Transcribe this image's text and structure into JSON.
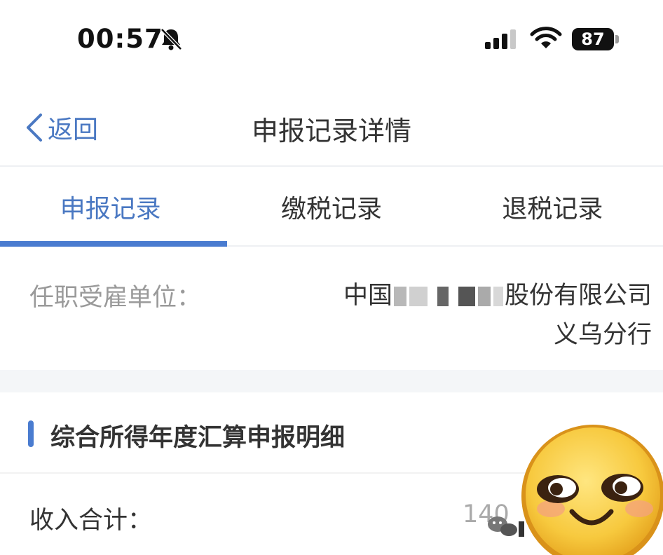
{
  "status_bar": {
    "time": "00:57",
    "battery": "87",
    "icons": [
      "bell-muted-icon",
      "cellular-signal-icon",
      "wifi-icon",
      "battery-icon"
    ]
  },
  "nav": {
    "back_label": "返回",
    "title": "申报记录详情"
  },
  "tabs": [
    {
      "label": "申报记录",
      "active": true
    },
    {
      "label": "缴税记录",
      "active": false
    },
    {
      "label": "退税记录",
      "active": false
    }
  ],
  "employer": {
    "label": "任职受雇单位：",
    "value_prefix": "中国",
    "value_suffix": "股份有限公司",
    "value_line2": "义乌分行"
  },
  "section": {
    "title": "综合所得年度汇算申报明细"
  },
  "income": {
    "label": "收入合计：",
    "value_partial": "140"
  },
  "colors": {
    "accent": "#4a7cd0",
    "link": "#4a78c2",
    "divider": "#eef0f3",
    "band": "#f4f6f8"
  }
}
